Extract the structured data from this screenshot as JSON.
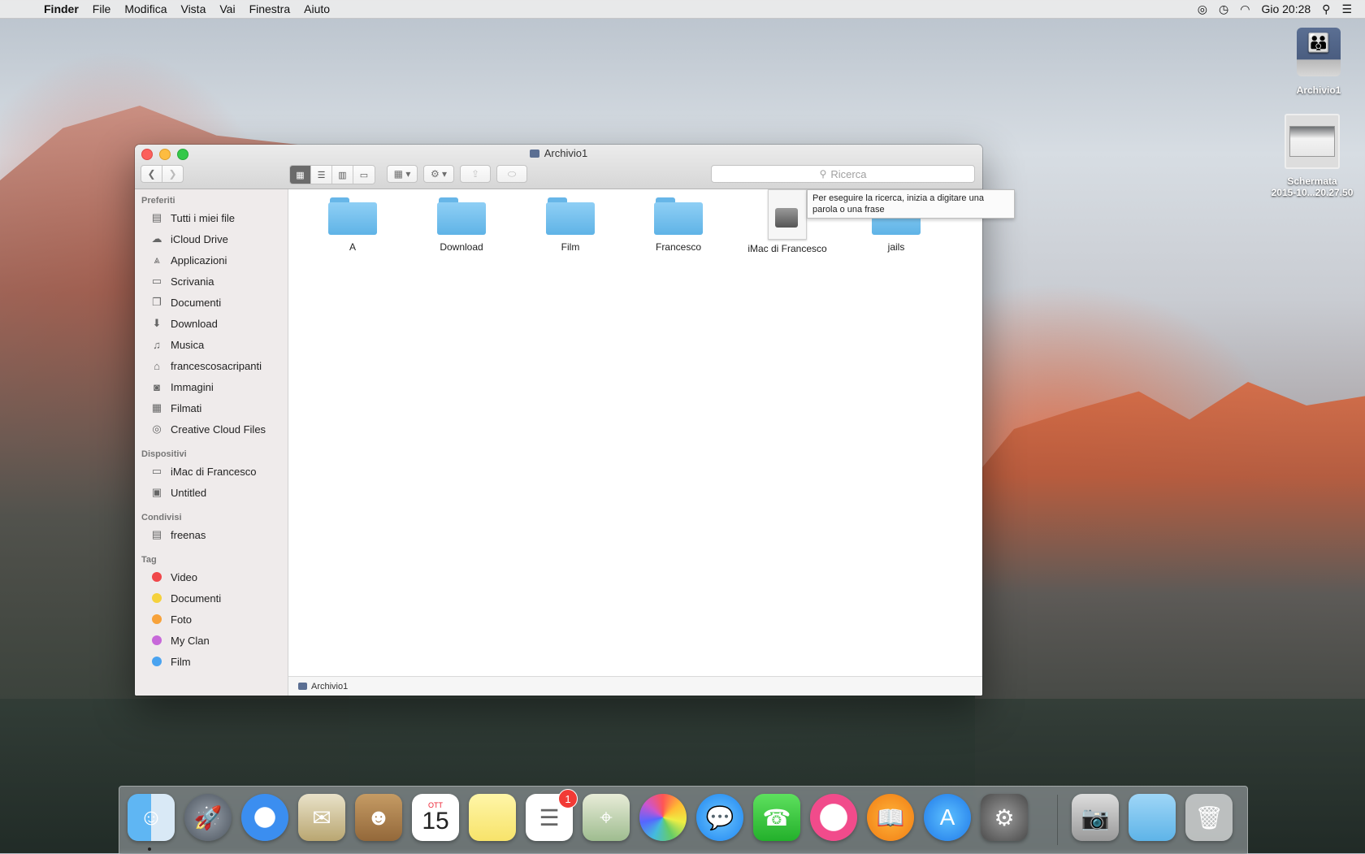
{
  "menubar": {
    "app": "Finder",
    "items": [
      "File",
      "Modifica",
      "Vista",
      "Vai",
      "Finestra",
      "Aiuto"
    ],
    "clock": "Gio 20:28"
  },
  "desktop": {
    "icons": [
      {
        "label": "Archivio1"
      },
      {
        "label_line1": "Schermata",
        "label_line2": "2015-10...20.27.50"
      }
    ]
  },
  "window": {
    "title": "Archivio1",
    "search_placeholder": "Ricerca",
    "tooltip": "Per eseguire la ricerca, inizia a digitare una parola o una frase",
    "status_path": "Archivio1"
  },
  "sidebar": {
    "sections": [
      {
        "title": "Preferiti",
        "items": [
          "Tutti i miei file",
          "iCloud Drive",
          "Applicazioni",
          "Scrivania",
          "Documenti",
          "Download",
          "Musica",
          "francescosacripanti",
          "Immagini",
          "Filmati",
          "Creative Cloud Files"
        ]
      },
      {
        "title": "Dispositivi",
        "items": [
          "iMac di Francesco",
          "Untitled"
        ]
      },
      {
        "title": "Condivisi",
        "items": [
          "freenas"
        ]
      },
      {
        "title": "Tag",
        "items": [
          {
            "label": "Video",
            "color": "#f0474a"
          },
          {
            "label": "Documenti",
            "color": "#f5d13c"
          },
          {
            "label": "Foto",
            "color": "#f7a23a"
          },
          {
            "label": "My Clan",
            "color": "#c768d9"
          },
          {
            "label": "Film",
            "color": "#4aa3f0"
          }
        ]
      }
    ]
  },
  "files": [
    {
      "name": "A",
      "type": "folder"
    },
    {
      "name": "Download",
      "type": "folder"
    },
    {
      "name": "Film",
      "type": "folder"
    },
    {
      "name": "Francesco",
      "type": "folder"
    },
    {
      "name": "iMac di Francesco",
      "type": "disk-image"
    },
    {
      "name": "jails",
      "type": "folder"
    }
  ],
  "dock": {
    "calendar_month": "OTT",
    "calendar_day": "15",
    "reminders_badge": "1"
  }
}
